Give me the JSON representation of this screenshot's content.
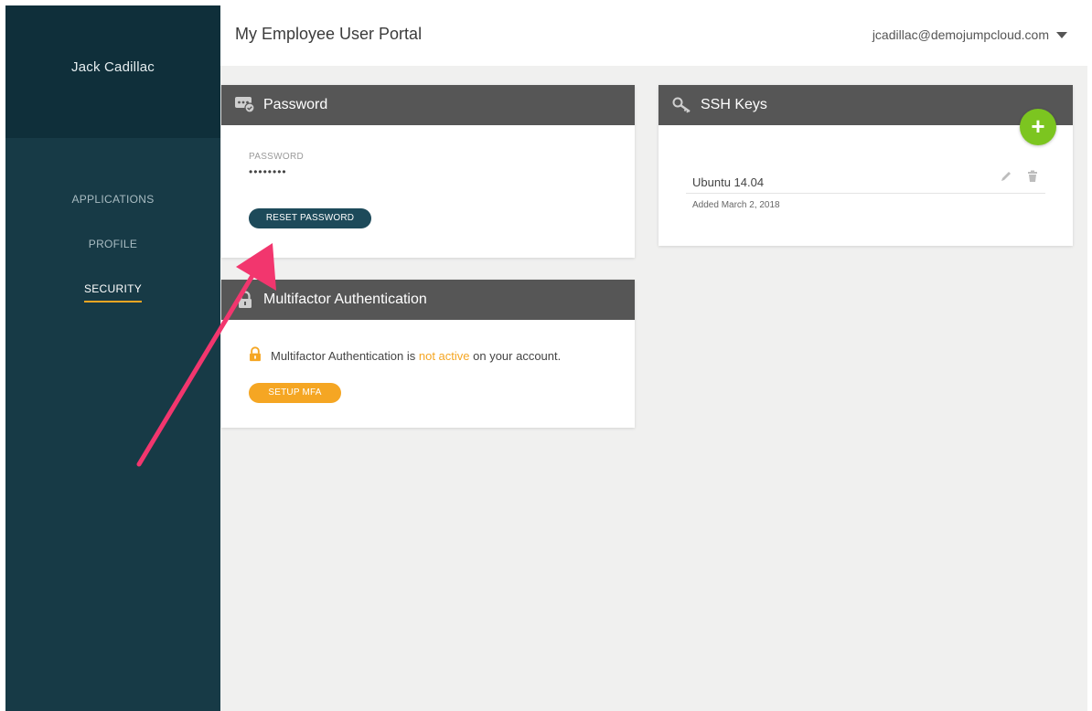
{
  "sidebar": {
    "user_name": "Jack Cadillac",
    "items": [
      {
        "label": "APPLICATIONS",
        "active": false
      },
      {
        "label": "PROFILE",
        "active": false
      },
      {
        "label": "SECURITY",
        "active": true
      }
    ]
  },
  "header": {
    "title": "My Employee User Portal",
    "user_email": "jcadillac@demojumpcloud.com",
    "menu_icon": "caret-down-icon"
  },
  "password_card": {
    "title": "Password",
    "icon": "password-icon",
    "field_label": "PASSWORD",
    "field_value": "••••••••",
    "reset_label": "RESET PASSWORD"
  },
  "mfa_card": {
    "title": "Multifactor Authentication",
    "icon": "lock-icon",
    "status_prefix": "Multifactor Authentication is ",
    "status_state": "not active",
    "status_suffix": " on your account.",
    "setup_label": "SETUP MFA"
  },
  "ssh_card": {
    "title": "SSH Keys",
    "icon": "key-icon",
    "add_label": "+",
    "keys": [
      {
        "name": "Ubuntu 14.04",
        "added": "Added March 2, 2018"
      }
    ]
  },
  "colors": {
    "sidebar": "#173a46",
    "sidebar_head": "#0f2f3a",
    "card_header": "#565656",
    "primary_button": "#1d4a5a",
    "accent_orange": "#f5a623",
    "add_green": "#7cc520",
    "annotation_arrow": "#f2366e"
  }
}
